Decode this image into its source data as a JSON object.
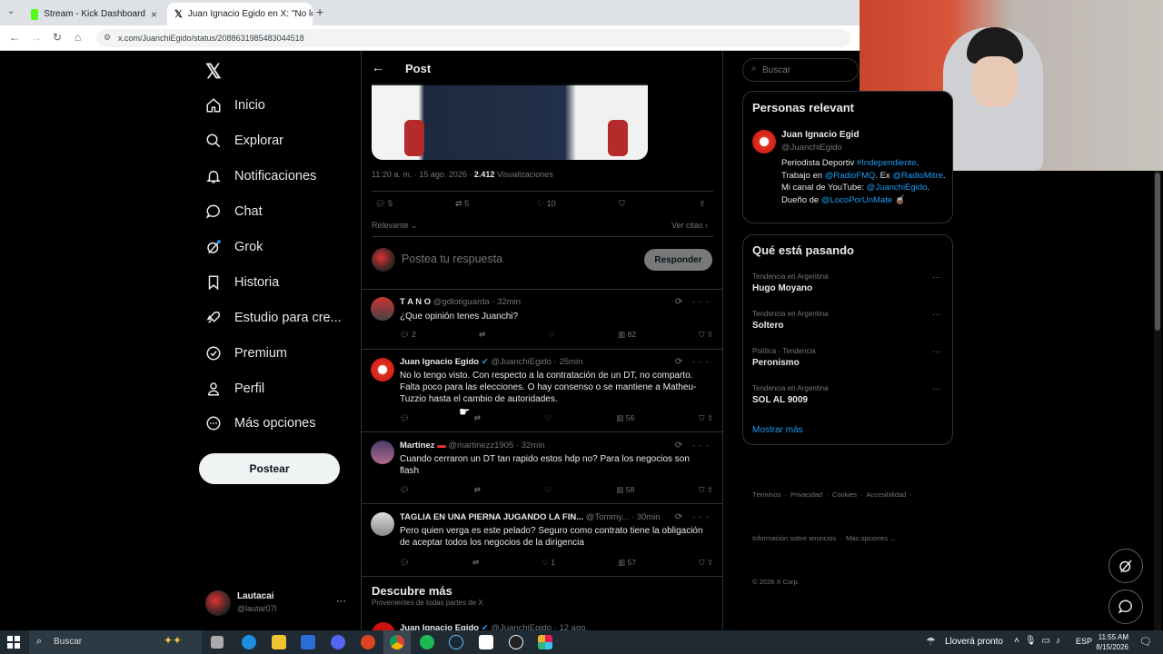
{
  "browser": {
    "tabs": [
      {
        "label": "Stream - Kick Dashboard",
        "icon": "kick-icon"
      },
      {
        "label": "Juan Ignacio Egido en X: \"No lo t...",
        "icon": "x-icon"
      }
    ],
    "new_tab": "+",
    "url": "x.com/JuanchiEgido/status/2088631985483044518"
  },
  "sidebar": {
    "items": [
      {
        "label": "Inicio",
        "icon": "home-icon"
      },
      {
        "label": "Explorar",
        "icon": "search-icon"
      },
      {
        "label": "Notificaciones",
        "icon": "bell-icon"
      },
      {
        "label": "Chat",
        "icon": "chat-icon"
      },
      {
        "label": "Grok",
        "icon": "grok-icon"
      },
      {
        "label": "Historia",
        "icon": "bookmark-icon"
      },
      {
        "label": "Estudio para cre...",
        "icon": "rocket-icon"
      },
      {
        "label": "Premium",
        "icon": "verified-icon"
      },
      {
        "label": "Perfil",
        "icon": "person-icon"
      },
      {
        "label": "Más opciones",
        "icon": "more-circle-icon"
      }
    ],
    "post_button": "Postear",
    "account": {
      "name": "Lautacai",
      "handle": "@lautar07l"
    }
  },
  "main": {
    "header_title": "Post",
    "post_meta": {
      "time": "11:20 a. m. · 15 ago. 2026 · ",
      "views": "2.412",
      "views_label": " Visualizaciones"
    },
    "post_stats": {
      "replies": "5",
      "reposts": "5",
      "likes": "10"
    },
    "sort_label": "Relevante",
    "quotes_label": "Ver citas",
    "reply_placeholder": "Postea tu respuesta",
    "reply_button": "Responder",
    "replies": [
      {
        "name": "T A N O",
        "handle": "@gdlotiguarda · 32min",
        "text": "¿Que opinión tenes Juanchi?",
        "replies": "2",
        "reposts": "",
        "likes": "",
        "views": "82"
      },
      {
        "name": "Juan Ignacio Egido",
        "handle": "@JuanchiEgido · 25min",
        "text": "No lo tengo visto. Con respecto a la contratación de un DT, no comparto. Falta poco para las elecciones. O hay consenso o se mantiene a Matheu-Tuzzio hasta el cambio de autoridades.",
        "replies": "",
        "reposts": "",
        "likes": "",
        "views": "56"
      },
      {
        "name": "Martinez",
        "handle": "@martinezz1905 · 32min",
        "text": "Cuando cerraron un DT tan rapido estos hdp no? Para los negocios son flash",
        "replies": "",
        "reposts": "",
        "likes": "",
        "views": "58"
      },
      {
        "name": "TAGLIA EN UNA PIERNA JUGANDO LA FIN...",
        "handle": "@Tommy... · 30min",
        "text": "Pero quien verga es este pelado? Seguro como contrato tiene la obligación de aceptar todos los negocios de la dirigencia",
        "replies": "",
        "reposts": "",
        "likes": "1",
        "views": "57"
      }
    ],
    "discover_title": "Descubre más",
    "discover_subtitle": "Provenientes de todas partes de X",
    "discover_peek": {
      "name": "Juan Ignacio Egido",
      "handle": "@JuanchiEgido · 12 ago."
    }
  },
  "right": {
    "search_placeholder": "Buscar",
    "relevant": {
      "title": "Personas relevant",
      "name": "Juan Ignacio Egid",
      "handle": "@JuanchiEgido",
      "bio_start": "Periodista Deportiv",
      "bio_link1": "#Independiente",
      "bio_mid1": ". Trabajo en ",
      "bio_link2": "@RadioFMQ",
      "bio_mid2": ". Ex ",
      "bio_link3": "@RadioMitre",
      "bio_mid3": ". Mi canal de YouTube: ",
      "bio_link4": "@JuanchiEgido",
      "bio_mid4": ". Dueño de ",
      "bio_link5": "@LocoPorUnMate",
      "bio_end": " 🧉"
    },
    "trends": {
      "title": "Qué está pasando",
      "items": [
        {
          "context": "Tendencia en Argentina",
          "name": "Hugo Moyano"
        },
        {
          "context": "Tendencia en Argentina",
          "name": "Soltero"
        },
        {
          "context": "Política · Tendencia",
          "name": "Peronismo"
        },
        {
          "context": "Tendencia en Argentina",
          "name": "SOL AL 9009"
        }
      ],
      "show_more": "Mostrar más"
    },
    "footer": {
      "line1": "Términos  ·  Privacidad  ·  Cookies  ·  Accesibilidad  ·",
      "line2": "Información sobre anuncios  ·  Más opciones ...",
      "line3": "© 2026 X Corp."
    }
  },
  "taskbar": {
    "search_placeholder": "Buscar",
    "weather": "Lloverá pronto",
    "lang": "ESP",
    "time": "11:55 AM",
    "date": "8/15/2026"
  },
  "colors": {
    "accent": "#1d9bf0",
    "bg": "#000000",
    "border": "#2f3336"
  }
}
